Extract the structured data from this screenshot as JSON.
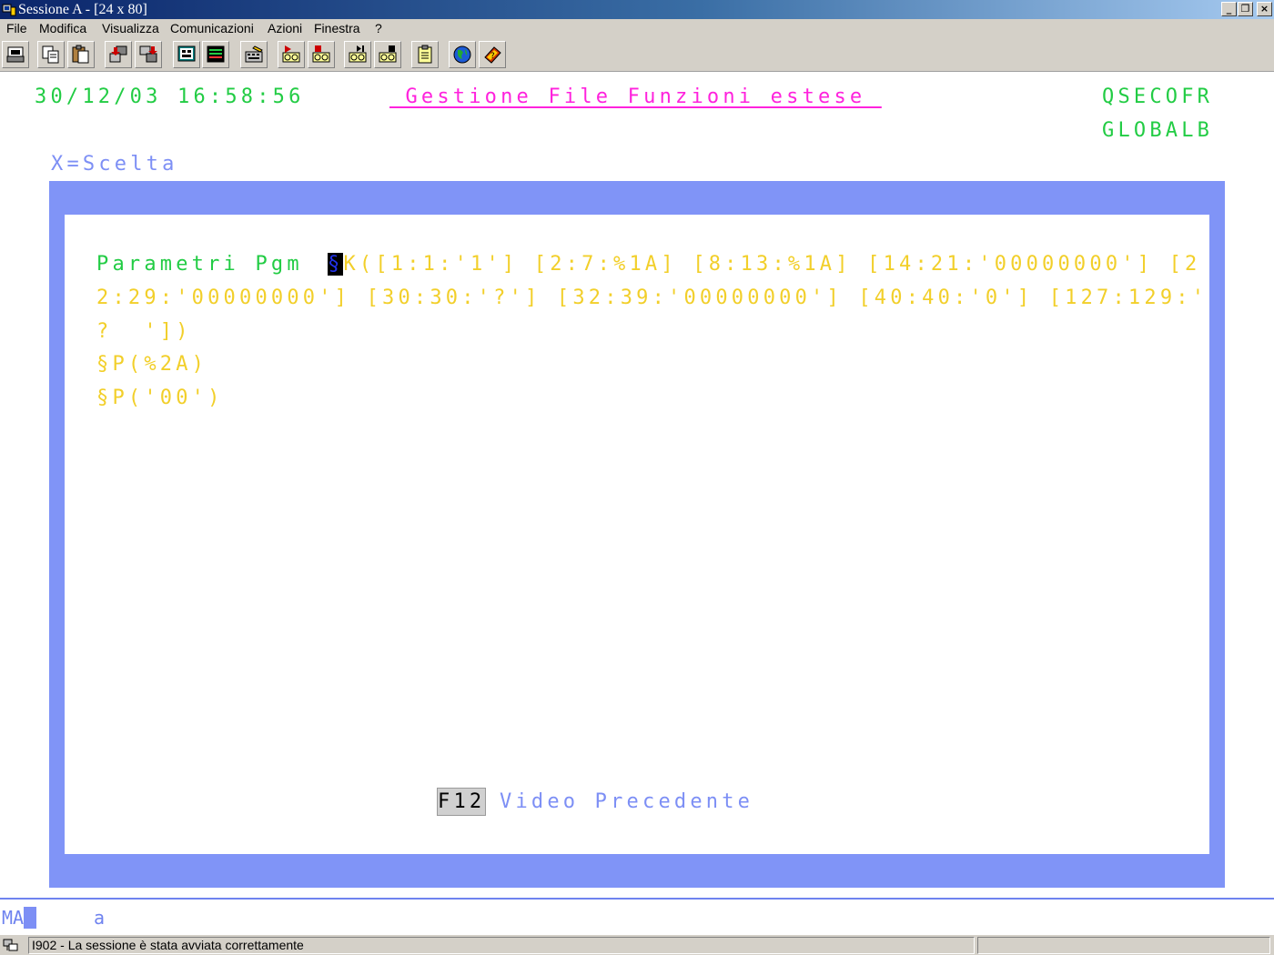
{
  "window": {
    "title": "Sessione A - [24 x 80]",
    "minimize_glyph": "_",
    "maximize_glyph": "❐",
    "close_glyph": "×"
  },
  "menu": [
    "File",
    "Modifica",
    "Visualizza",
    "Comunicazioni",
    "Azioni",
    "Finestra",
    "?"
  ],
  "toolbar": {
    "icons": [
      "print-screen-icon",
      "copy-icon",
      "paste-icon",
      "send-icon",
      "receive-icon",
      "display-options-icon",
      "color-map-icon",
      "edit-keyboard-icon",
      "record-macro-icon",
      "stop-macro-icon",
      "play-macro-icon",
      "macro-save-icon",
      "clipboard-icon",
      "web-globe-icon",
      "help-book-icon"
    ]
  },
  "screen": {
    "datetime": "30/12/03 16:58:56",
    "title": " Gestione File Funzioni estese ",
    "user": "QSECOFR",
    "system": "GLOBALB",
    "option_hint": "X=Scelta",
    "param_label": "Parametri Pgm",
    "param_cursor_char": "§",
    "param_line1": "K([1:1:'1'] [2:7:%1A] [8:13:%1A] [14:21:'00000000'] [2",
    "param_line2": "2:29:'00000000'] [30:30:'?'] [32:39:'00000000'] [40:40:'0'] [127:129:'",
    "param_line3": "?  '])",
    "param_line4": "§P(%2A)",
    "param_line5": "§P('00')",
    "fkey_label": "F12",
    "fkey_desc": "Video Precedente"
  },
  "oia": {
    "mode": "MA",
    "indicator": "a"
  },
  "status": {
    "message": "I902 - La sessione è stata avviata correttamente",
    "right": ""
  },
  "colors": {
    "frame": "#8094f7",
    "green": "#22cc44",
    "magenta": "#ff22dd",
    "yellow": "#f2cf2a",
    "blue": "#7d8ff5"
  }
}
